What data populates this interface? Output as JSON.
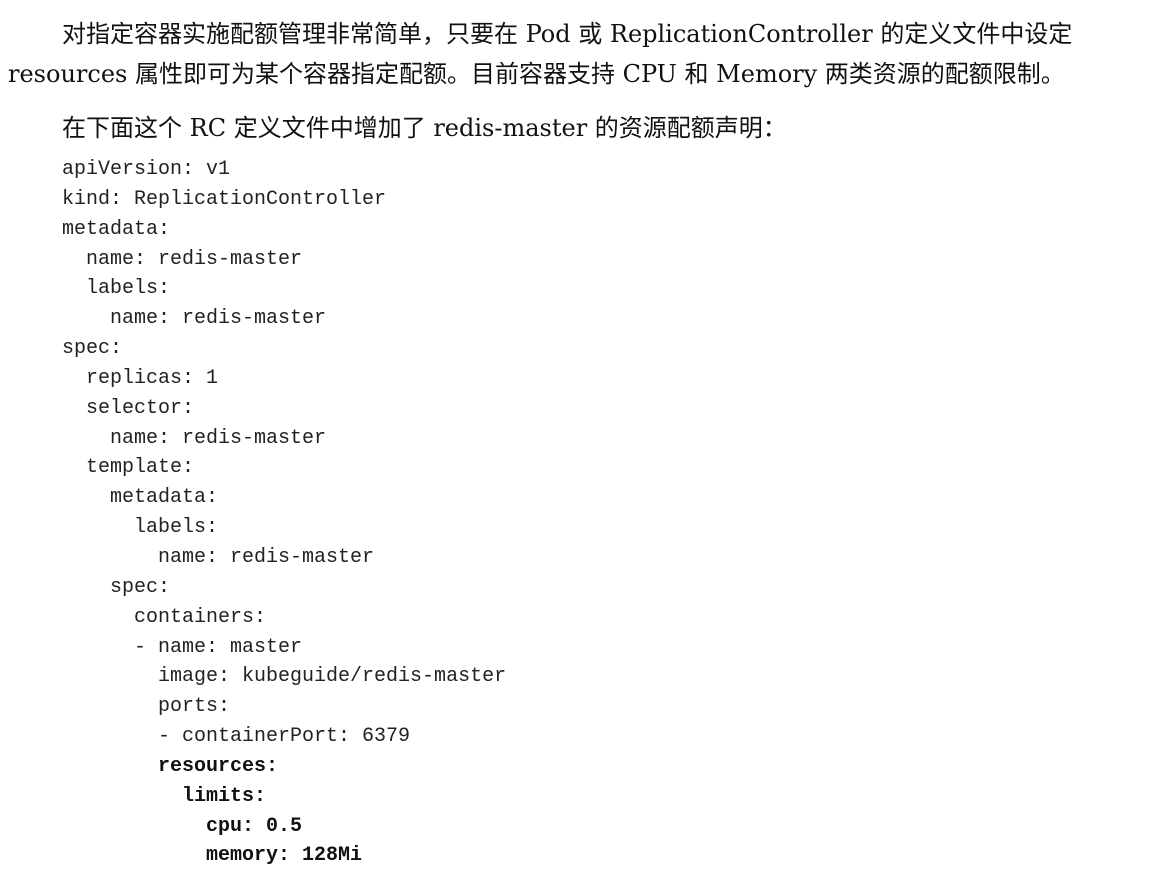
{
  "text": {
    "paragraph1_line1": "对指定容器实施配额管理非常简单，只要在 Pod 或 ReplicationController 的定义文件中设定",
    "paragraph1_line2": "resources 属性即可为某个容器指定配额。目前容器支持 CPU 和 Memory 两类资源的配额限制。",
    "paragraph2": "在下面这个 RC 定义文件中增加了 redis-master 的资源配额声明："
  },
  "code_lines": [
    {
      "text": "apiVersion: v1",
      "bold": false
    },
    {
      "text": "kind: ReplicationController",
      "bold": false
    },
    {
      "text": "metadata:",
      "bold": false
    },
    {
      "text": "  name: redis-master",
      "bold": false
    },
    {
      "text": "  labels:",
      "bold": false
    },
    {
      "text": "    name: redis-master",
      "bold": false
    },
    {
      "text": "spec:",
      "bold": false
    },
    {
      "text": "  replicas: 1",
      "bold": false
    },
    {
      "text": "  selector:",
      "bold": false
    },
    {
      "text": "    name: redis-master",
      "bold": false
    },
    {
      "text": "  template:",
      "bold": false
    },
    {
      "text": "    metadata:",
      "bold": false
    },
    {
      "text": "      labels:",
      "bold": false
    },
    {
      "text": "        name: redis-master",
      "bold": false
    },
    {
      "text": "    spec:",
      "bold": false
    },
    {
      "text": "      containers:",
      "bold": false
    },
    {
      "text": "      - name: master",
      "bold": false
    },
    {
      "text": "        image: kubeguide/redis-master",
      "bold": false
    },
    {
      "text": "        ports:",
      "bold": false
    },
    {
      "text": "        - containerPort: 6379",
      "bold": false
    },
    {
      "text": "        resources:",
      "bold": true
    },
    {
      "text": "          limits:",
      "bold": true
    },
    {
      "text": "            cpu: 0.5",
      "bold": true
    },
    {
      "text": "            memory: 128Mi",
      "bold": true
    }
  ]
}
